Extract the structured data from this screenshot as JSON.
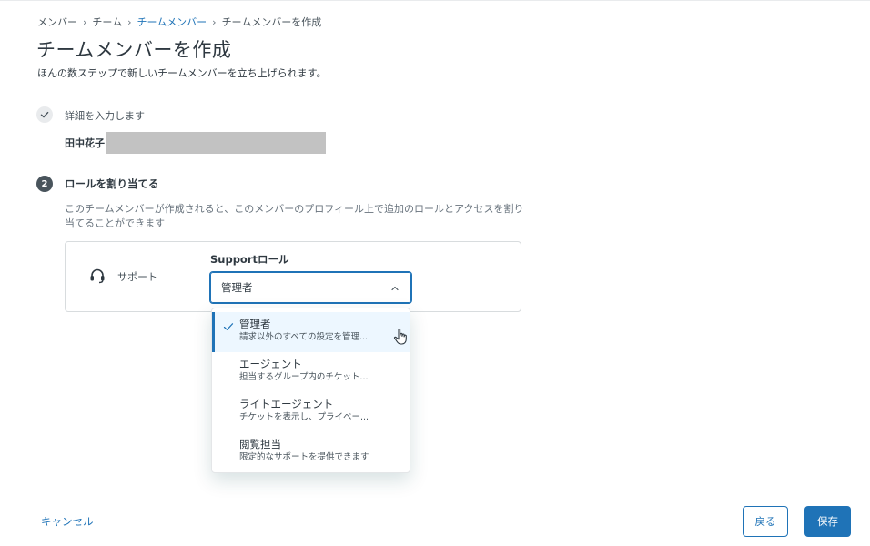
{
  "breadcrumb": {
    "items": [
      "メンバー",
      "チーム",
      "チームメンバー",
      "チームメンバーを作成"
    ],
    "separator": "›"
  },
  "header": {
    "title": "チームメンバーを作成",
    "subtitle": "ほんの数ステップで新しいチームメンバーを立ち上げられます。"
  },
  "steps": {
    "step1": {
      "label": "詳細を入力します",
      "name": "田中花子"
    },
    "step2": {
      "number": "2",
      "label": "ロールを割り当てる",
      "description": "このチームメンバーが作成されると、このメンバーのプロフィール上で追加のロールとアクセスを割り当てることができます"
    }
  },
  "role_card": {
    "product": "サポート",
    "field_label": "Supportロール",
    "selected_value": "管理者",
    "options": [
      {
        "title": "管理者",
        "description": "請求以外のすべての設定を管理...",
        "selected": true
      },
      {
        "title": "エージェント",
        "description": "担当するグループ内のチケット...",
        "selected": false
      },
      {
        "title": "ライトエージェント",
        "description": "チケットを表示し、プライベー...",
        "selected": false
      },
      {
        "title": "閲覧担当",
        "description": "限定的なサポートを提供できます",
        "selected": false
      }
    ]
  },
  "footer": {
    "cancel_label": "キャンセル",
    "back_label": "戻る",
    "save_label": "保存"
  },
  "colors": {
    "accent": "#1f73b7",
    "text": "#2f3941",
    "muted": "#68737d",
    "selected_bg": "#edf7ff"
  },
  "icons": {
    "step_done": "check-icon",
    "product": "headset-icon",
    "select": "chevron-up-icon",
    "selected_option": "check-icon",
    "pointer": "hand-cursor-icon"
  }
}
